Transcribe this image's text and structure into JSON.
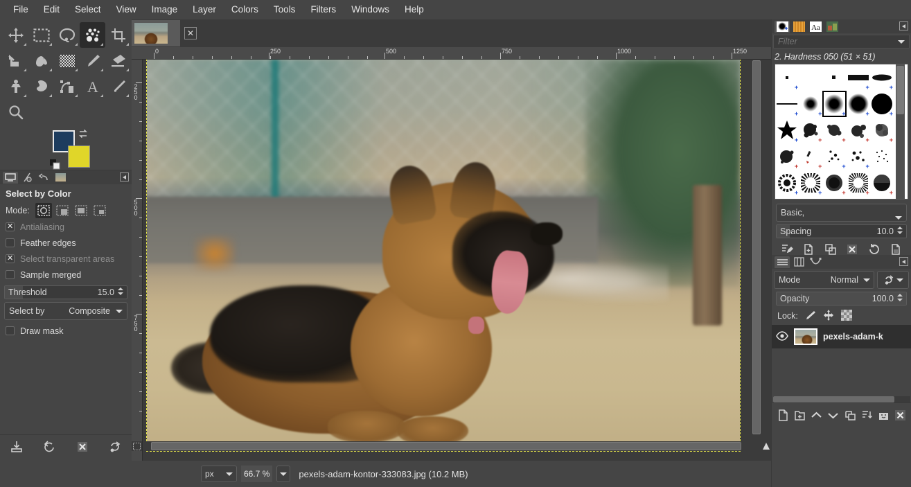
{
  "app": {
    "title": "GIMP",
    "window_theme_bg": "#454545"
  },
  "menubar": {
    "items": [
      {
        "label": "File"
      },
      {
        "label": "Edit"
      },
      {
        "label": "Select"
      },
      {
        "label": "View"
      },
      {
        "label": "Image"
      },
      {
        "label": "Layer"
      },
      {
        "label": "Colors"
      },
      {
        "label": "Tools"
      },
      {
        "label": "Filters"
      },
      {
        "label": "Windows"
      },
      {
        "label": "Help"
      }
    ]
  },
  "toolbox": {
    "tools": [
      {
        "name": "move-tool",
        "active": false
      },
      {
        "name": "rectangle-select-tool",
        "active": false
      },
      {
        "name": "free-select-tool",
        "active": false
      },
      {
        "name": "select-by-color-tool",
        "active": true
      },
      {
        "name": "crop-tool",
        "active": false
      },
      {
        "name": "transform-tool",
        "active": false
      },
      {
        "name": "bucket-fill-tool",
        "active": false
      },
      {
        "name": "gradient-tool",
        "active": false
      },
      {
        "name": "paintbrush-tool",
        "active": false
      },
      {
        "name": "eraser-tool",
        "active": false
      },
      {
        "name": "clone-tool",
        "active": false
      },
      {
        "name": "smudge-tool",
        "active": false
      },
      {
        "name": "paths-tool",
        "active": false
      },
      {
        "name": "text-tool",
        "active": false
      },
      {
        "name": "color-picker-tool",
        "active": false
      },
      {
        "name": "zoom-tool",
        "active": false
      }
    ],
    "foreground_color": "#1d3c5e",
    "background_color": "#e0d629"
  },
  "tool_options": {
    "dock_tabs": [
      {
        "name": "tool-options-tab",
        "active": true
      },
      {
        "name": "device-status-tab",
        "active": false
      },
      {
        "name": "undo-history-tab",
        "active": false
      },
      {
        "name": "images-tab",
        "active": false
      }
    ],
    "title": "Select by Color",
    "mode_label": "Mode:",
    "modes": [
      {
        "name": "replace-selection",
        "active": true
      },
      {
        "name": "add-to-selection",
        "active": false
      },
      {
        "name": "subtract-from-selection",
        "active": false
      },
      {
        "name": "intersect-with-selection",
        "active": false
      }
    ],
    "checkboxes": [
      {
        "label": "Antialiasing",
        "checked": true,
        "dim": true
      },
      {
        "label": "Feather edges",
        "checked": false,
        "dim": false
      },
      {
        "label": "Select transparent areas",
        "checked": true,
        "dim": true
      },
      {
        "label": "Sample merged",
        "checked": false,
        "dim": false
      }
    ],
    "threshold": {
      "label": "Threshold",
      "value": "15.0",
      "fill_pct": 15
    },
    "select_by": {
      "label": "Select by",
      "value": "Composite"
    },
    "draw_mask": {
      "label": "Draw mask",
      "checked": false
    },
    "bottom_icons": [
      {
        "name": "save-tool-options-icon"
      },
      {
        "name": "restore-tool-options-icon"
      },
      {
        "name": "delete-tool-options-icon"
      },
      {
        "name": "reset-tool-options-icon"
      }
    ]
  },
  "canvas": {
    "tab": {
      "title": "pexels-adam-kontor-333083.jpg",
      "close_label": "✕"
    },
    "ruler_h_labels": [
      "0",
      "250",
      "500",
      "750",
      "1000",
      "1250"
    ],
    "ruler_v_labels": [
      "250",
      "500",
      "750"
    ],
    "selection_marching_ants": true,
    "image": {
      "subject": "German Shepherd dog lying on dry grass",
      "background": "blurred chain-link fence, concrete wall, shrubs, wooden post"
    }
  },
  "statusbar": {
    "unit": "px",
    "zoom": "66.7 %",
    "text": "pexels-adam-kontor-333083.jpg (10.2 MB)"
  },
  "brushes_dock": {
    "tabs": [
      {
        "name": "brushes-tab",
        "active": true
      },
      {
        "name": "patterns-tab",
        "active": false
      },
      {
        "name": "fonts-tab",
        "label": "Aa",
        "active": false
      },
      {
        "name": "images-tab",
        "active": false
      }
    ],
    "filter_placeholder": "Filter",
    "filter_value": "",
    "selected_brush": "2. Hardness 050 (51 × 51)",
    "tag_filter": "Basic,",
    "spacing": {
      "label": "Spacing",
      "value": "10.0",
      "fill_pct": 10
    },
    "action_icons": [
      {
        "name": "edit-brush-icon"
      },
      {
        "name": "new-brush-icon"
      },
      {
        "name": "duplicate-brush-icon"
      },
      {
        "name": "delete-brush-icon"
      },
      {
        "name": "refresh-brushes-icon"
      },
      {
        "name": "open-brush-as-image-icon"
      }
    ],
    "grid": [
      {
        "name": "brush-1-1",
        "kind": "dot-tiny",
        "selected": false,
        "plus": "blue"
      },
      {
        "name": "brush-1-2",
        "kind": "blank",
        "selected": false,
        "plus": ""
      },
      {
        "name": "brush-1-3",
        "kind": "dot-small",
        "selected": false,
        "plus": ""
      },
      {
        "name": "brush-1-4",
        "kind": "bar",
        "selected": false,
        "plus": "blue"
      },
      {
        "name": "brush-1-5",
        "kind": "ellipse",
        "selected": false,
        "plus": "blue"
      },
      {
        "name": "brush-2-1",
        "kind": "line",
        "selected": false,
        "plus": "blue"
      },
      {
        "name": "brush-2-2",
        "kind": "soft-small",
        "selected": false,
        "plus": "blue"
      },
      {
        "name": "brush-2-3",
        "kind": "soft-med",
        "selected": true,
        "plus": "blue"
      },
      {
        "name": "brush-2-4",
        "kind": "soft-large",
        "selected": false,
        "plus": "blue"
      },
      {
        "name": "brush-2-5",
        "kind": "hard-circle",
        "selected": false,
        "plus": "blue"
      },
      {
        "name": "brush-3-1",
        "kind": "star",
        "selected": false,
        "plus": "blue"
      },
      {
        "name": "brush-3-2",
        "kind": "splatter",
        "selected": false,
        "plus": "red"
      },
      {
        "name": "brush-3-3",
        "kind": "splatter",
        "selected": false,
        "plus": "red"
      },
      {
        "name": "brush-3-4",
        "kind": "splatter",
        "selected": false,
        "plus": "red"
      },
      {
        "name": "brush-3-5",
        "kind": "splatter",
        "selected": false,
        "plus": "red"
      },
      {
        "name": "brush-4-1",
        "kind": "splatter",
        "selected": false,
        "plus": "red"
      },
      {
        "name": "brush-4-2",
        "kind": "sparse",
        "selected": false,
        "plus": "red"
      },
      {
        "name": "brush-4-3",
        "kind": "sparse",
        "selected": false,
        "plus": "blue"
      },
      {
        "name": "brush-4-4",
        "kind": "sparse",
        "selected": false,
        "plus": "blue"
      },
      {
        "name": "brush-4-5",
        "kind": "sparse",
        "selected": false,
        "plus": ""
      },
      {
        "name": "brush-5-1",
        "kind": "texture",
        "selected": false,
        "plus": "blue"
      },
      {
        "name": "brush-5-2",
        "kind": "texture",
        "selected": false,
        "plus": "blue"
      },
      {
        "name": "brush-5-3",
        "kind": "texture",
        "selected": false,
        "plus": "red"
      },
      {
        "name": "brush-5-4",
        "kind": "texture",
        "selected": false,
        "plus": "red"
      },
      {
        "name": "brush-5-5",
        "kind": "texture",
        "selected": false,
        "plus": "red"
      }
    ]
  },
  "layers_dock": {
    "tabs": [
      {
        "name": "layers-tab",
        "active": true
      },
      {
        "name": "channels-tab",
        "active": false
      },
      {
        "name": "paths-tab",
        "active": false
      }
    ],
    "mode": {
      "label": "Mode",
      "value": "Normal"
    },
    "opacity": {
      "label": "Opacity",
      "value": "100.0",
      "fill_pct": 100
    },
    "lock": {
      "label": "Lock:",
      "items": [
        {
          "name": "lock-pixels-icon"
        },
        {
          "name": "lock-position-icon"
        },
        {
          "name": "lock-alpha-icon"
        }
      ]
    },
    "layers": [
      {
        "name": "pexels-adam-k",
        "visible": true,
        "selected": true
      }
    ],
    "bottom_icons": [
      {
        "name": "new-layer-icon"
      },
      {
        "name": "new-layer-group-icon"
      },
      {
        "name": "raise-layer-icon"
      },
      {
        "name": "lower-layer-icon"
      },
      {
        "name": "duplicate-layer-icon"
      },
      {
        "name": "merge-down-icon"
      },
      {
        "name": "add-layer-mask-icon"
      },
      {
        "name": "delete-layer-icon"
      }
    ]
  }
}
